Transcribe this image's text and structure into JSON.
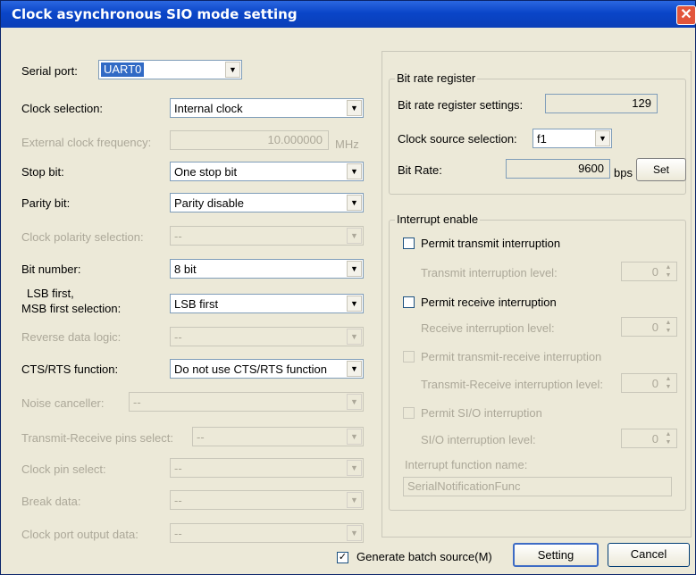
{
  "window": {
    "title": "Clock asynchronous SIO mode setting",
    "close_label": "✕"
  },
  "left": {
    "serial_port": {
      "label": "Serial port:",
      "value": "UART0"
    },
    "clock_selection": {
      "label": "Clock selection:",
      "value": "Internal clock"
    },
    "external_clock": {
      "label": "External clock frequency:",
      "value": "10.000000",
      "unit": "MHz"
    },
    "stop_bit": {
      "label": "Stop bit:",
      "value": "One stop bit"
    },
    "parity_bit": {
      "label": "Parity bit:",
      "value": "Parity disable"
    },
    "clock_polarity": {
      "label": "Clock polarity selection:",
      "value": "--"
    },
    "bit_number": {
      "label": "Bit number:",
      "value": "8 bit"
    },
    "lsb_msb": {
      "label_line1": "LSB first,",
      "label_line2": "MSB first selection:",
      "value": "LSB first"
    },
    "reverse_data": {
      "label": "Reverse data logic:",
      "value": "--"
    },
    "cts_rts": {
      "label": "CTS/RTS function:",
      "value": "Do not use CTS/RTS function"
    },
    "noise_canceller": {
      "label": "Noise canceller:",
      "value": "--"
    },
    "tx_rx_pins": {
      "label": "Transmit-Receive pins select:",
      "value": "--"
    },
    "clock_pin": {
      "label": "Clock pin select:",
      "value": "--"
    },
    "break_data": {
      "label": "Break data:",
      "value": "--"
    },
    "clock_port_output": {
      "label": "Clock port output data:",
      "value": "--"
    }
  },
  "bitrate": {
    "group_title": "Bit rate register",
    "settings_label": "Bit rate register settings:",
    "settings_value": "129",
    "clock_source_label": "Clock source selection:",
    "clock_source_value": "f1",
    "bit_rate_label": "Bit Rate:",
    "bit_rate_value": "9600",
    "bit_rate_unit": "bps",
    "set_details_label": "Set details..."
  },
  "interrupt": {
    "group_title": "Interrupt enable",
    "transmit": {
      "label": "Permit transmit interruption",
      "level_label": "Transmit interruption level:",
      "level": "0"
    },
    "receive": {
      "label": "Permit receive interruption",
      "level_label": "Receive interruption level:",
      "level": "0"
    },
    "tx_rx": {
      "label": "Permit transmit-receive interruption",
      "level_label": "Transmit-Receive interruption level:",
      "level": "0"
    },
    "sio": {
      "label": "Permit SI/O interruption",
      "level_label": "SI/O interruption level:",
      "level": "0"
    },
    "function_name_label": "Interrupt function name:",
    "function_name_value": "SerialNotificationFunc"
  },
  "footer": {
    "generate_batch_label": "Generate batch source(M)",
    "generate_batch_checked": "✓",
    "setting_label": "Setting",
    "cancel_label": "Cancel"
  }
}
